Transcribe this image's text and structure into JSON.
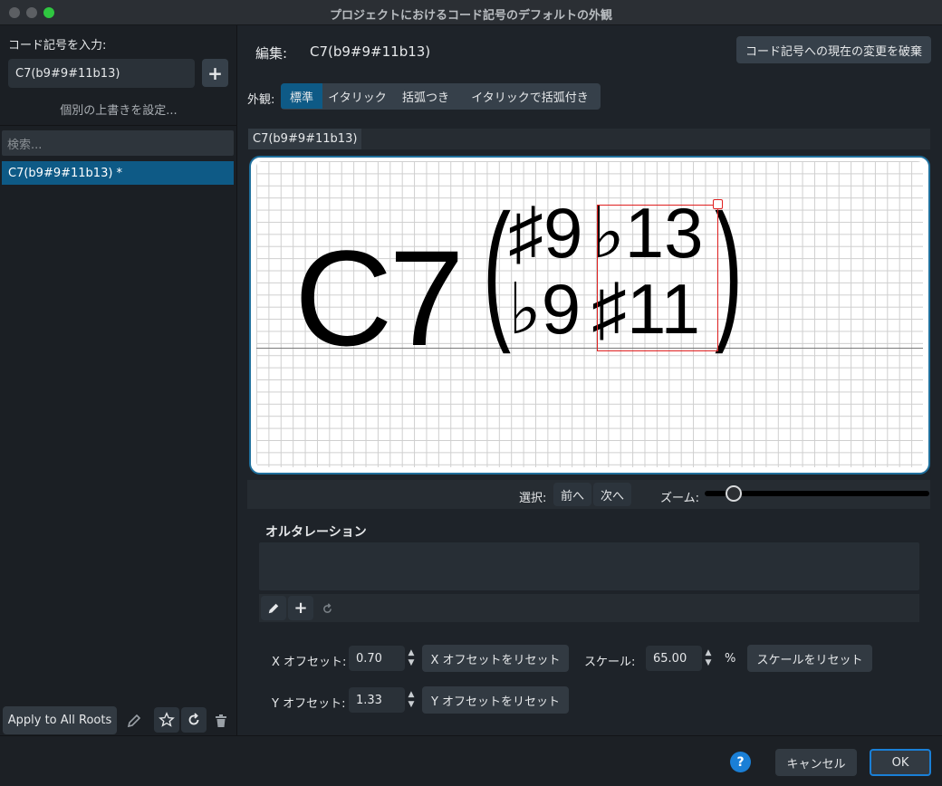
{
  "window": {
    "title": "プロジェクトにおけるコード記号のデフォルトの外観"
  },
  "left": {
    "input_label": "コード記号を入力:",
    "input_value": "C7(b9#9#11b13)",
    "add_symbol": "+",
    "override_label": "個別の上書きを設定...",
    "search_placeholder": "検索...",
    "list": [
      {
        "label": "C7(b9#9#11b13) *"
      }
    ],
    "apply_all_label": "Apply to All Roots"
  },
  "header": {
    "edit_label": "編集:",
    "edit_value": "C7(b9#9#11b13)",
    "discard_label": "コード記号への現在の変更を破棄"
  },
  "appearance": {
    "label": "外観:",
    "options": [
      "標準",
      "イタリック",
      "括弧つき",
      "イタリックで括弧付き"
    ],
    "selected": "標準"
  },
  "preview": {
    "tab_label": "C7(b9#9#11b13)",
    "root": "C7",
    "upper_row": [
      "♯9",
      "♭13"
    ],
    "lower_row": [
      "♭9",
      "♯11"
    ],
    "open_paren": "(",
    "close_paren": ")"
  },
  "navigation": {
    "select_label": "選択:",
    "prev_label": "前へ",
    "next_label": "次へ",
    "zoom_label": "ズーム:",
    "zoom_level": 0.13
  },
  "alterations": {
    "title": "オルタレーション"
  },
  "offsets": {
    "x_label": "X オフセット:",
    "x_value": "0.70",
    "x_reset": "X オフセットをリセット",
    "y_label": "Y オフセット:",
    "y_value": "1.33",
    "y_reset": "Y オフセットをリセット",
    "scale_label": "スケール:",
    "scale_value": "65.00",
    "scale_unit": "%",
    "scale_reset": "スケールをリセット"
  },
  "footer": {
    "help_symbol": "?",
    "cancel_label": "キャンセル",
    "ok_label": "OK"
  },
  "colors": {
    "accent": "#1f6f9c",
    "selection": "#0e5a86",
    "highlight_box": "#e02020",
    "help": "#1a7fd6"
  }
}
